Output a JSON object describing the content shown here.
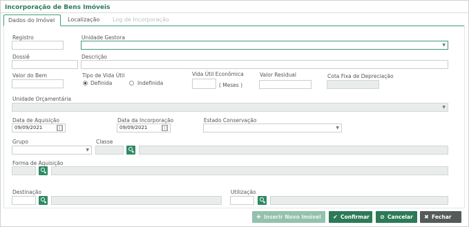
{
  "header": {
    "title": "Incorporação de Bens Imóveis"
  },
  "tabs": {
    "dados": "Dados do Imóvel",
    "localizacao": "Localização",
    "log": "Log de Incorporação"
  },
  "form": {
    "registro": {
      "label": "Registro",
      "value": ""
    },
    "unidade_gestora": {
      "label": "Unidade Gestora",
      "value": ""
    },
    "dossie": {
      "label": "Dossiê",
      "value": ""
    },
    "descricao": {
      "label": "Descrição",
      "value": ""
    },
    "valor_bem": {
      "label": "Valor do Bem",
      "value": ""
    },
    "tipo_vida_util": {
      "label": "Tipo de Vida Útil",
      "options": [
        "Definida",
        "Indefinida"
      ],
      "selected": "Definida"
    },
    "vida_util": {
      "label": "Vida Útil Econômica",
      "value": "",
      "unit": "( Meses )"
    },
    "valor_residual": {
      "label": "Valor Residual",
      "value": ""
    },
    "cota_fixa": {
      "label": "Cota Fixa de Depreciação",
      "value": ""
    },
    "unidade_orcamentaria": {
      "label": "Unidade Orçamentária",
      "value": ""
    },
    "data_aquisicao": {
      "label": "Data de Aquisição",
      "value": "09/09/2021"
    },
    "data_incorporacao": {
      "label": "Data da Incorporação",
      "value": "09/09/2021"
    },
    "estado_conservacao": {
      "label": "Estado Conservação",
      "value": ""
    },
    "grupo": {
      "label": "Grupo",
      "value": ""
    },
    "classe": {
      "label": "Classe",
      "code": "",
      "description": ""
    },
    "forma_aquisicao": {
      "label": "Forma de Aquisição",
      "code": "",
      "description": ""
    },
    "destinacao": {
      "label": "Destinação",
      "code": "",
      "description": ""
    },
    "utilizacao": {
      "label": "Utilização",
      "code": "",
      "description": ""
    }
  },
  "buttons": {
    "inserir": "Inserir Novo Imóvel",
    "confirmar": "Confirmar",
    "cancelar": "Cancelar",
    "fechar": "Fechar"
  },
  "icons": {
    "plus": "plus-icon",
    "check": "check-icon",
    "cancel": "ban-icon",
    "close": "x-icon",
    "search": "search-icon",
    "calendar": "calendar-icon",
    "dropdown": "chevron-down-icon"
  },
  "colors": {
    "accent": "#2c7a57",
    "title": "#2c7a5a",
    "disabled_button": "#93c1ad",
    "close_button": "#555b58"
  }
}
